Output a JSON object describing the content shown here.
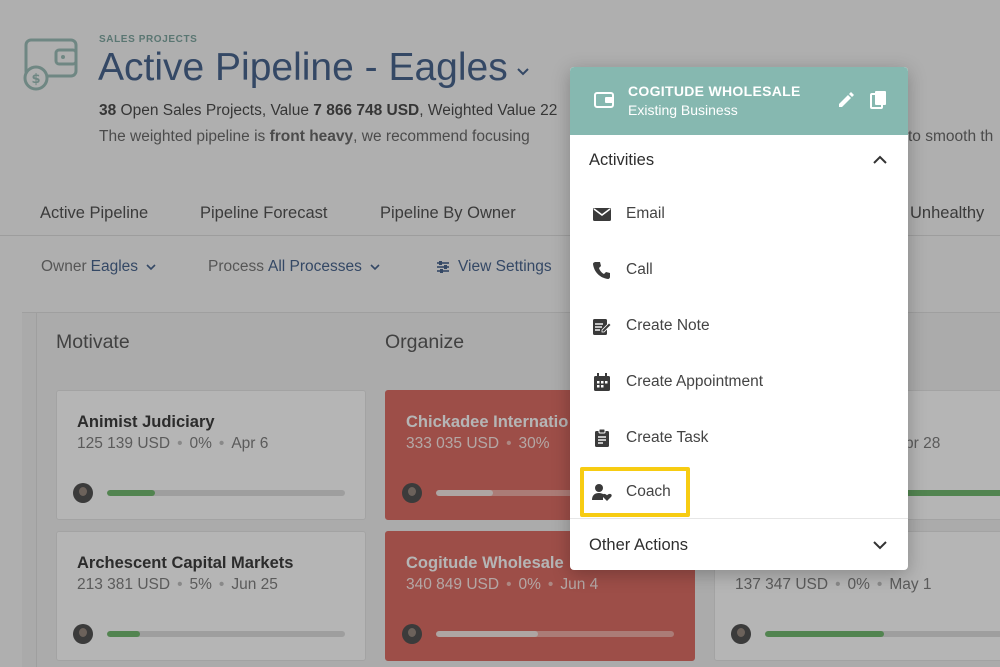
{
  "header": {
    "kicker": "SALES PROJECTS",
    "title": "Active Pipeline - Eagles",
    "summary": {
      "count": "38",
      "text1": " Open Sales Projects, Value ",
      "value": "7 866 748 USD",
      "text2": ", Weighted Value 22"
    },
    "advice": {
      "text1": "The weighted pipeline is ",
      "bold": "front heavy",
      "text2": ", we recommend focusing ",
      "tail": "to smooth th"
    }
  },
  "tabs": [
    "Active Pipeline",
    "Pipeline Forecast",
    "Pipeline By Owner",
    "Unhealthy"
  ],
  "filters": {
    "owner_label": "Owner",
    "owner_value": "Eagles",
    "process_label": "Process",
    "process_value": "All Processes",
    "view_settings": "View Settings"
  },
  "board": {
    "columns": [
      "Motivate",
      "Organize"
    ],
    "cards": [
      {
        "name": "Animist Judiciary",
        "value": "125 139 USD",
        "pct": "0%",
        "date": "Apr 6",
        "progress": 0.2
      },
      {
        "name": "Archescent Capital Markets",
        "value": "213 381 USD",
        "pct": "5%",
        "date": "Jun 25",
        "progress": 0.14
      },
      {
        "name": "Chickadee Internatio",
        "value": "333 035 USD",
        "pct": "30%",
        "date": "",
        "progress": 0.24
      },
      {
        "name": "Cogitude Wholesale",
        "value": "340 849 USD",
        "pct": "0%",
        "date": "Jun 4",
        "progress": 0.43
      },
      {
        "name": "",
        "value": "",
        "pct": "",
        "date": "pr 28",
        "progress": 1.0
      },
      {
        "name": "",
        "value": "137 347 USD",
        "pct": "0%",
        "date": "May 1",
        "progress": 0.5
      }
    ]
  },
  "popover": {
    "company": "COGITUDE WHOLESALE",
    "subtitle": "Existing Business",
    "activities_label": "Activities",
    "items": [
      {
        "label": "Email",
        "icon": "email-icon"
      },
      {
        "label": "Call",
        "icon": "phone-icon"
      },
      {
        "label": "Create Note",
        "icon": "note-edit-icon"
      },
      {
        "label": "Create Appointment",
        "icon": "calendar-icon"
      },
      {
        "label": "Create Task",
        "icon": "clipboard-icon"
      },
      {
        "label": "Coach",
        "icon": "coach-icon"
      }
    ],
    "other_actions_label": "Other Actions"
  },
  "colors": {
    "accent_blue": "#2f4f7f",
    "teal_header": "#86b8b0",
    "card_red": "#d85a4f",
    "progress_green": "#5fb15c",
    "highlight_yellow": "#f7cc12"
  }
}
